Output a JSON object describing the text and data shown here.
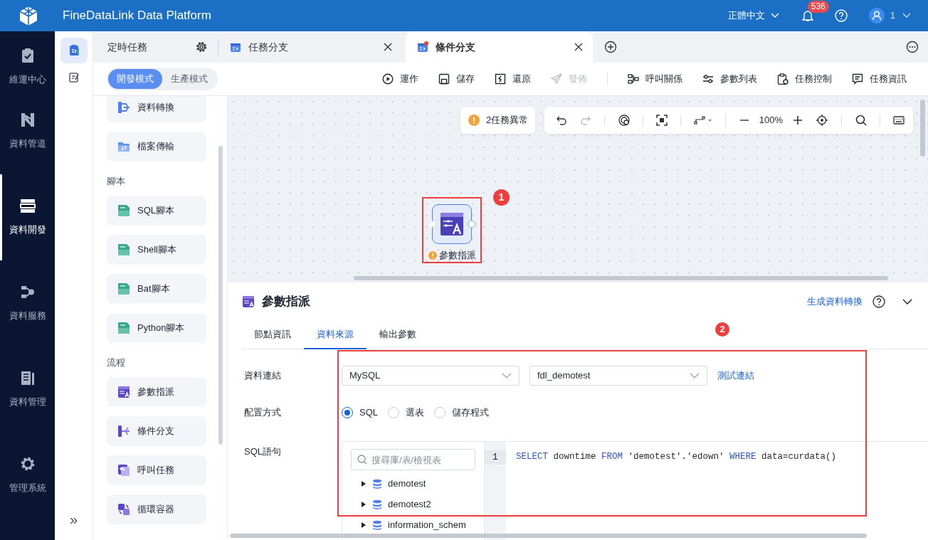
{
  "header": {
    "title": "FineDataLink Data Platform",
    "language": "正體中文",
    "notification_count": "536",
    "user": "1"
  },
  "nav": {
    "items": [
      {
        "label": "維運中心",
        "kind": "ops",
        "selected": false
      },
      {
        "label": "資料管道",
        "kind": "pipeline",
        "selected": false
      },
      {
        "label": "資料開發",
        "kind": "dev",
        "selected": true
      },
      {
        "label": "資料服務",
        "kind": "service",
        "selected": false
      },
      {
        "label": "資料管理",
        "kind": "manage",
        "selected": false
      },
      {
        "label": "管理系統",
        "kind": "system",
        "selected": false
      }
    ],
    "collapse": "»"
  },
  "subnav": [
    {
      "kind": "tasks",
      "selected": true
    },
    {
      "kind": "notes",
      "selected": false
    }
  ],
  "tabs": [
    {
      "label": "定時任務",
      "kind": "settings",
      "selected": false,
      "modified": false
    },
    {
      "label": "任務分支",
      "kind": "task",
      "selected": false,
      "modified": false
    },
    {
      "label": "條件分支",
      "kind": "task",
      "selected": true,
      "modified": true
    }
  ],
  "modes": [
    {
      "label": "開發模式",
      "selected": true
    },
    {
      "label": "生產模式",
      "selected": false
    }
  ],
  "actions": [
    {
      "label": "運作",
      "kind": "run",
      "disabled": false,
      "divider_after": false
    },
    {
      "label": "儲存",
      "kind": "save",
      "disabled": false,
      "divider_after": false
    },
    {
      "label": "還原",
      "kind": "restore",
      "disabled": false,
      "divider_after": false
    },
    {
      "label": "發佈",
      "kind": "publish",
      "disabled": true,
      "divider_after": true
    },
    {
      "label": "呼叫關係",
      "kind": "calls",
      "disabled": false,
      "divider_after": false
    },
    {
      "label": "參數列表",
      "kind": "params",
      "disabled": false,
      "divider_after": false
    },
    {
      "label": "任務控制",
      "kind": "control",
      "disabled": false,
      "divider_after": false
    },
    {
      "label": "任務資訊",
      "kind": "info",
      "disabled": false,
      "divider_after": false
    }
  ],
  "palette": [
    {
      "items": [
        {
          "label": "資料轉換",
          "kind": "transform"
        },
        {
          "label": "檔案傳輸",
          "kind": "file"
        }
      ]
    },
    {
      "heading": "腳本",
      "items": [
        {
          "label": "SQL腳本",
          "kind": "script"
        },
        {
          "label": "Shell腳本",
          "kind": "script"
        },
        {
          "label": "Bat腳本",
          "kind": "script"
        },
        {
          "label": "Python腳本",
          "kind": "script"
        }
      ]
    },
    {
      "heading": "流程",
      "items": [
        {
          "label": "參數指派",
          "kind": "assign"
        },
        {
          "label": "條件分支",
          "kind": "branch"
        },
        {
          "label": "呼叫任務",
          "kind": "call"
        },
        {
          "label": "循環容器",
          "kind": "loop"
        }
      ]
    }
  ],
  "canvas": {
    "alert": "2任務異常",
    "zoom": "100%",
    "nodes": [
      {
        "label": "參數指派",
        "warning": true
      }
    ],
    "annotations": [
      "1",
      "2"
    ]
  },
  "panel": {
    "title": "參數指派",
    "link": "生成資料轉換",
    "tabs": [
      {
        "label": "節點資訊",
        "selected": false
      },
      {
        "label": "資料來源",
        "selected": true
      },
      {
        "label": "輸出參數",
        "selected": false
      }
    ],
    "connection_label": "資料連結",
    "db_type": "MySQL",
    "connection": "fdl_demotest",
    "test_link": "測試連結",
    "mode_label": "配置方式",
    "config_modes": [
      {
        "label": "SQL",
        "selected": true
      },
      {
        "label": "選表",
        "selected": false
      },
      {
        "label": "儲存程式",
        "selected": false
      }
    ],
    "sql_label": "SQL語句",
    "search_placeholder": "搜尋庫/表/檢視表",
    "tree": [
      {
        "label": "demotest",
        "expanded": false
      },
      {
        "label": "demotest2",
        "expanded": false
      },
      {
        "label": "information_schem",
        "expanded": false
      }
    ],
    "line_number": "1",
    "code": [
      {
        "text": "SELECT",
        "kind": "keyword"
      },
      {
        "text": " downtime ",
        "kind": "plain"
      },
      {
        "text": "FROM",
        "kind": "keyword"
      },
      {
        "text": " 'demotest'.'edown' ",
        "kind": "plain"
      },
      {
        "text": "WHERE",
        "kind": "keyword"
      },
      {
        "text": " data=curdata()",
        "kind": "plain"
      }
    ]
  }
}
